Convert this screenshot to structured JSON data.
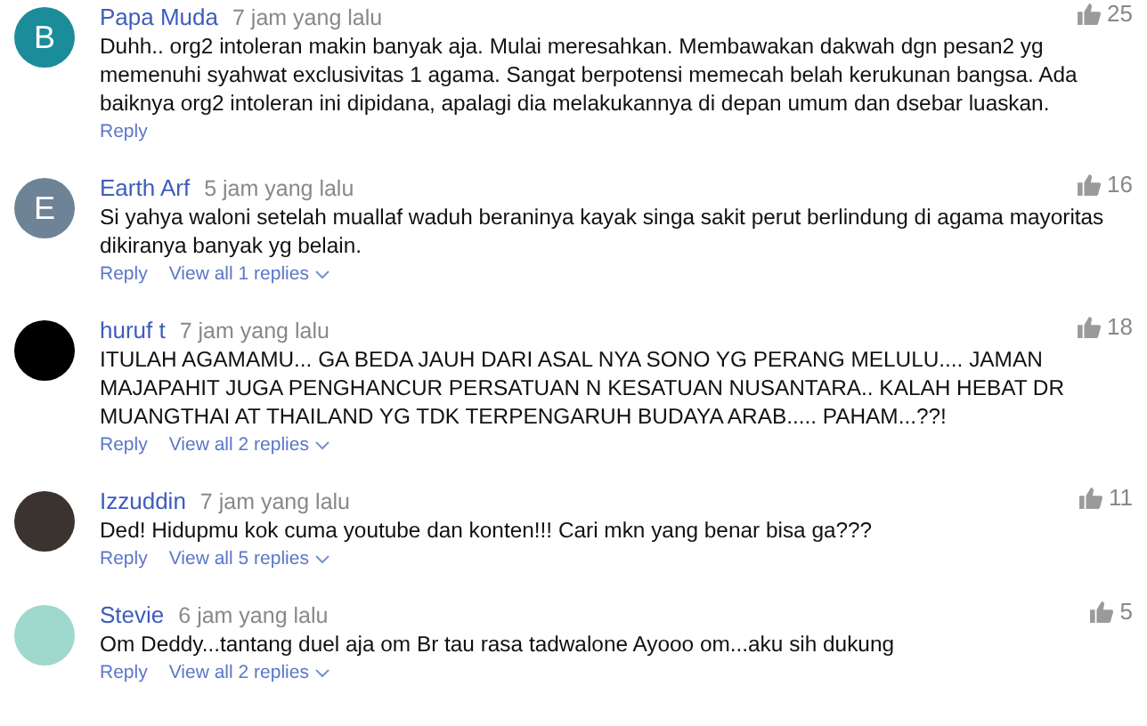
{
  "comments": [
    {
      "avatar": {
        "kind": "letter",
        "letter": "B",
        "color": "#1b8c99"
      },
      "name": "Papa Muda",
      "time": "7 jam yang lalu",
      "likes": "25",
      "text": "Duhh.. org2 intoleran makin banyak aja. Mulai meresahkan. Membawakan dakwah dgn pesan2 yg memenuhi syahwat exclusivitas 1 agama. Sangat berpotensi memecah belah kerukunan bangsa. Ada baiknya org2 intoleran ini dipidana, apalagi dia melakukannya di depan umum dan dsebar luaskan.",
      "reply": "Reply"
    },
    {
      "avatar": {
        "kind": "letter",
        "letter": "E",
        "color": "#6e8496"
      },
      "name": "Earth Arf",
      "time": "5 jam yang lalu",
      "likes": "16",
      "text": "Si yahya waloni setelah muallaf waduh beraninya kayak singa sakit perut berlindung di agama mayoritas dikiranya banyak yg belain.",
      "reply": "Reply",
      "view_replies": "View all 1 replies"
    },
    {
      "avatar": {
        "kind": "plain",
        "color": "#000000"
      },
      "name": "huruf t",
      "time": "7 jam yang lalu",
      "likes": "18",
      "text": "ITULAH AGAMAMU... GA BEDA JAUH DARI ASAL NYA SONO YG PERANG MELULU.... JAMAN MAJAPAHIT JUGA PENGHANCUR PERSATUAN N KESATUAN NUSANTARA.. KALAH HEBAT DR MUANGTHAI AT THAILAND YG TDK TERPENGARUH BUDAYA ARAB..... PAHAM...??!",
      "reply": "Reply",
      "view_replies": "View all 2 replies"
    },
    {
      "avatar": {
        "kind": "photo",
        "color": "#3a3330"
      },
      "name": "Izzuddin",
      "time": "7 jam yang lalu",
      "likes": "11",
      "text": "Ded! Hidupmu kok cuma youtube dan konten!!! Cari mkn yang benar bisa ga???",
      "reply": "Reply",
      "view_replies": "View all 5 replies"
    },
    {
      "avatar": {
        "kind": "photo",
        "color": "#9fd8cc"
      },
      "name": "Stevie",
      "time": "6 jam yang lalu",
      "likes": "5",
      "text": "Om Deddy...tantang duel aja om Br tau rasa tadwalone Ayooo om...aku sih dukung",
      "reply": "Reply",
      "view_replies": "View all 2 replies"
    }
  ]
}
